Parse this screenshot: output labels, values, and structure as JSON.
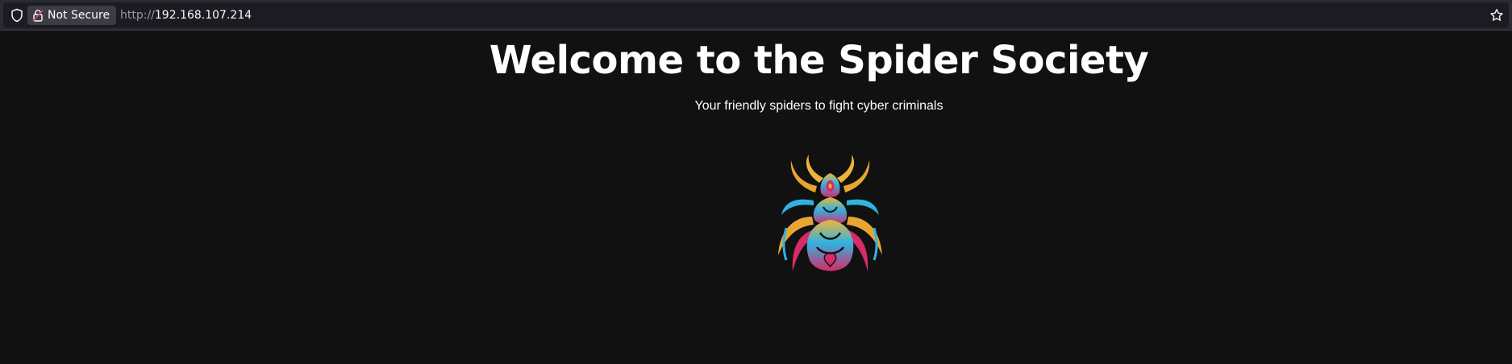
{
  "browser": {
    "security_label": "Not Secure",
    "url_scheme": "http://",
    "url_host": "192.168.107.214",
    "colors": {
      "toolbar": "#2b2a33",
      "urlbar": "#1c1b22",
      "chip": "#3d3c45",
      "insecure_accent": "#e2405f"
    },
    "icons": [
      "shield-icon",
      "insecure-lock-icon",
      "bookmark-star-icon"
    ]
  },
  "page": {
    "title": "Welcome to the Spider Society",
    "subtitle": "Your friendly spiders to fight cyber criminals",
    "logo_icon": "spider-logo",
    "colors": {
      "background": "#111111",
      "text": "#ffffff",
      "logo_gold": "#f0b43a",
      "logo_cyan": "#2fb4e0",
      "logo_magenta": "#d62a6a"
    }
  }
}
